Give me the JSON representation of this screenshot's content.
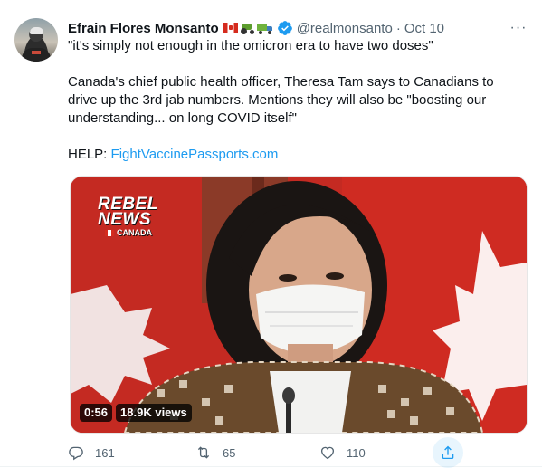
{
  "tweet": {
    "author": {
      "name": "Efrain Flores Monsanto",
      "handle": "@realmonsanto",
      "emoji_icons": [
        "canada-flag-icon",
        "tractor-icon",
        "truck-icon"
      ],
      "verified": true
    },
    "separator": "·",
    "date": "Oct 10",
    "more_label": "···",
    "lines": [
      "\"it's simply not enough in the omicron era to have two doses\"",
      "Canada's chief public health officer, Theresa Tam says to Canadians to drive up the 3rd jab numbers. Mentions they will also be \"boosting our understanding... on long COVID itself\""
    ],
    "help_label": "HELP:",
    "help_link": "FightVaccinePassports.com",
    "media": {
      "logo_line1": "REBEL",
      "logo_line2": "NEWS",
      "logo_line3": "CANADA",
      "duration": "0:56",
      "views": "18.9K views"
    },
    "actions": {
      "reply_count": "161",
      "retweet_count": "65",
      "like_count": "110"
    }
  },
  "colors": {
    "text": "#0f1419",
    "secondary": "#536471",
    "link": "#1d9bf0",
    "flag_red": "#d52b1e"
  }
}
